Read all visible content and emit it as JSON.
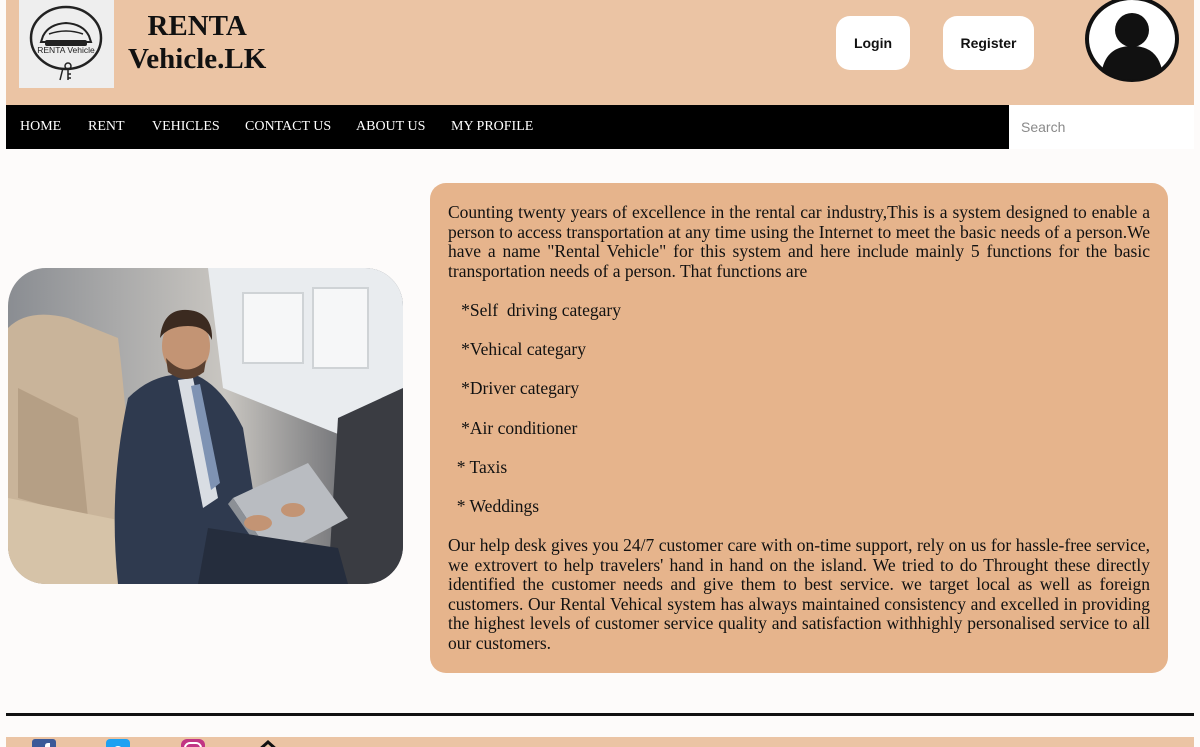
{
  "header": {
    "logo_text": "RENTA Vehicle",
    "brand_line1": "RENTA",
    "brand_line2": "Vehicle.LK",
    "login_label": "Login",
    "register_label": "Register",
    "avatar_icon": "user-avatar-icon"
  },
  "nav": {
    "items": [
      "HOME",
      "RENT",
      "VEHICLES",
      "CONTACT US",
      "ABOUT US",
      "MY PROFILE"
    ],
    "search_placeholder": "Search"
  },
  "main": {
    "image_icon": "businessman-in-car-photo",
    "intro": "Counting twenty years of  excellence in the rental car industry,This is a system designed to enable a person to access transportation at any time using the Internet to meet the basic needs of  a person.We have a name \"Rental Vehicle\" for this system and here include mainly 5 functions for the basic transportation needs of  a person. That functions are",
    "features": [
      "   *Self  driving categary",
      "   *Vehical categary",
      "   *Driver categary",
      "   *Air conditioner",
      "  * Taxis",
      "  * Weddings"
    ],
    "outro": "Our help desk gives you 24/7 customer care with on-time support, rely on us for hassle-free service, we extrovert to help travelers' hand in hand on the island. We tried to do Throught these directly identified the customer needs and give them to best service. we target local as well as foreign customers. Our Rental Vehical system has always maintained consistency and excelled in providing the highest levels of  customer service quality and satisfaction withhighly personalised service to all our customers."
  },
  "footer": {
    "icons": [
      "facebook-icon",
      "twitter-icon",
      "instagram-icon",
      "home-icon"
    ]
  },
  "colors": {
    "header_bg": "#ebc4a4",
    "card_bg": "#e6b48c",
    "nav_bg": "#000000"
  }
}
